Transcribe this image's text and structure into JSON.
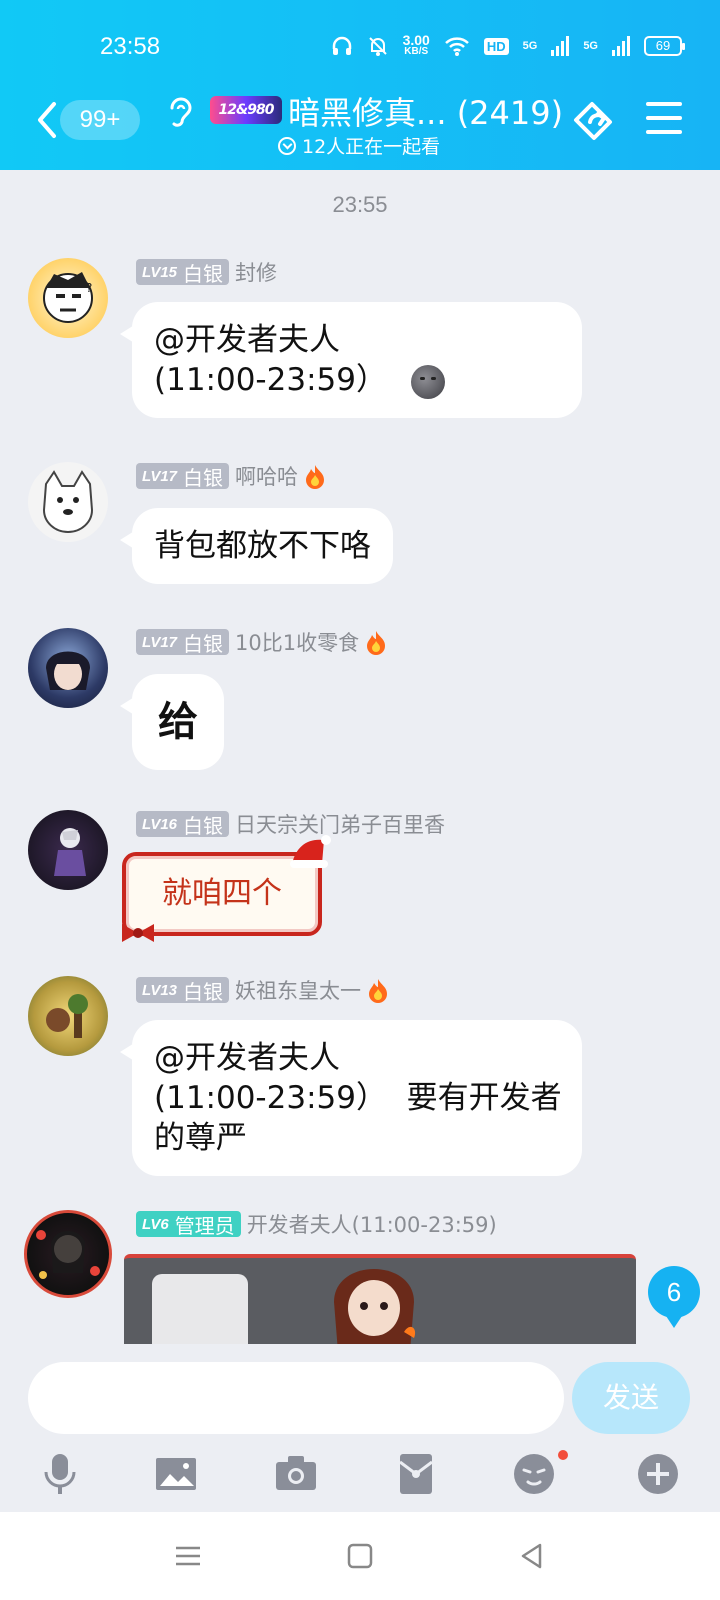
{
  "status_bar": {
    "time": "23:58",
    "net_speed_value": "3.00",
    "net_speed_unit": "KB/S",
    "hd_label": "HD",
    "signal1_label": "5G",
    "signal2_label": "5G",
    "battery": "69"
  },
  "header": {
    "unread_count": "99+",
    "logo_text": "12&980",
    "title": "暗黑修真... (2419)",
    "subtitle": "12人正在一起看"
  },
  "chat": {
    "timestamp": "23:55",
    "messages": [
      {
        "level": "LV15",
        "rank": "白银",
        "sender": "封修",
        "text_line1": "@开发者夫人",
        "text_line2": "(11:00-23:59）"
      },
      {
        "level": "LV17",
        "rank": "白银",
        "sender": "啊哈哈",
        "text": "背包都放不下咯"
      },
      {
        "level": "LV17",
        "rank": "白银",
        "sender": "10比1收零食",
        "text": "给"
      },
      {
        "level": "LV16",
        "rank": "白银",
        "sender": "日天宗关门弟子百里香",
        "text": "就咱四个"
      },
      {
        "level": "LV13",
        "rank": "白银",
        "sender": "妖祖东皇太一",
        "text_line1": "@开发者夫人",
        "text_line2": "(11:00-23:59）  要有开发者",
        "text_line3": "的尊严"
      },
      {
        "level": "LV6",
        "rank": "管理员",
        "sender": "开发者夫人(11:00-23:59)"
      }
    ],
    "new_message_count": "6"
  },
  "input": {
    "placeholder": "",
    "send_label": "发送"
  },
  "colors": {
    "header_accent": "#17b4f5",
    "badge_silver": "#b6bac6",
    "badge_admin": "#3fd1c3",
    "chat_bg": "#eceef3"
  }
}
